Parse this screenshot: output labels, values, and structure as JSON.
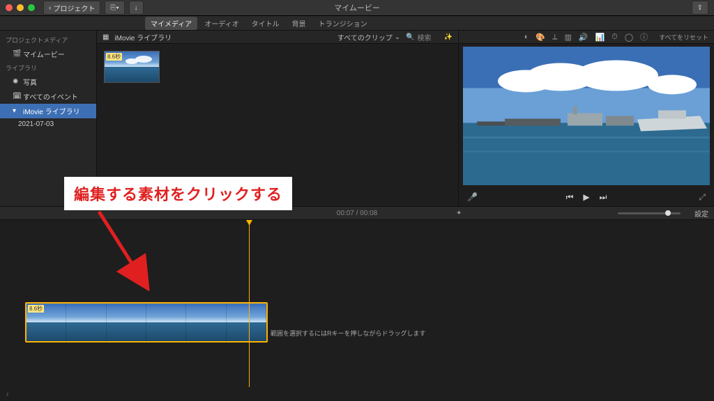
{
  "titlebar": {
    "back": "プロジェクト",
    "title": "マイムービー"
  },
  "tabs": [
    "マイメディア",
    "オーディオ",
    "タイトル",
    "背景",
    "トランジション"
  ],
  "tabs_active": 0,
  "sidebar": {
    "head1": "プロジェクトメディア",
    "item_my_movie": "マイムービー",
    "head2": "ライブラリ",
    "item_photos": "写真",
    "item_all_events": "すべてのイベント",
    "item_imovie_lib": "iMovie ライブラリ",
    "item_date": "2021-07-03"
  },
  "browser": {
    "title": "iMovie ライブラリ",
    "dropdown": "すべてのクリップ",
    "search_placeholder": "検索",
    "thumb_badge": "8.6秒"
  },
  "viewer": {
    "reset": "すべてをリセット"
  },
  "timebar": {
    "current": "00:07",
    "total": "00:08",
    "settings": "設定"
  },
  "timeline": {
    "clip_badge": "8.6秒",
    "hint": "範囲を選択するにはRキーを押しながらドラッグします"
  },
  "annotation": {
    "text": "編集する素材をクリックする"
  }
}
